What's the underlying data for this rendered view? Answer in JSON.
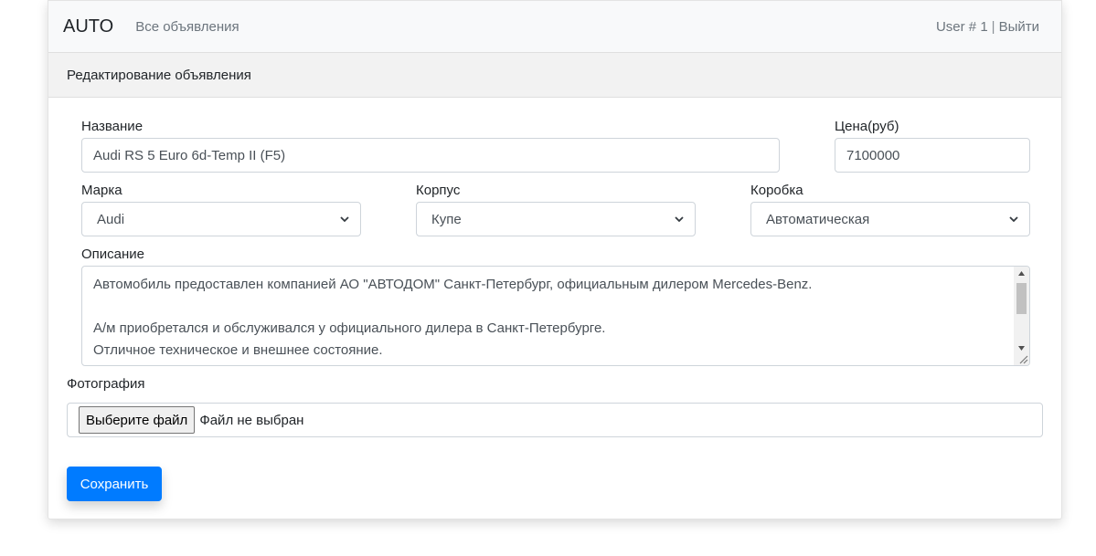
{
  "navbar": {
    "brand": "AUTO",
    "all_ads_link": "Все объявления",
    "user_label": "User # 1",
    "separator": "|",
    "logout_link": "Выйти"
  },
  "card": {
    "header_title": "Редактирование объявления"
  },
  "form": {
    "name": {
      "label": "Название",
      "value": "Audi RS 5 Euro 6d-Temp II (F5)"
    },
    "price": {
      "label": "Цена(руб)",
      "value": "7100000"
    },
    "brand": {
      "label": "Марка",
      "selected": "Audi",
      "icon": "chevron-down-icon"
    },
    "body": {
      "label": "Корпус",
      "selected": "Купе",
      "icon": "chevron-down-icon"
    },
    "gearbox": {
      "label": "Коробка",
      "selected": "Автоматическая",
      "icon": "chevron-down-icon"
    },
    "description": {
      "label": "Описание",
      "lines": [
        "Автомобиль предоставлен компанией АО \"АВТОДОМ\" Санкт-Петербург, официальным дилером Mercedes-Benz.",
        "",
        "А/м приобретался и обслуживался у официального дилера в Санкт-Петербурге.",
        "Отличное техническое и внешнее состояние."
      ]
    },
    "photo": {
      "label": "Фотография",
      "button_label": "Выберите файл",
      "status": "Файл не выбран"
    },
    "save_label": "Сохранить"
  },
  "colors": {
    "primary": "#007bff",
    "navbar_bg": "#f8f9fa",
    "header_bg": "#f2f2f2",
    "muted_text": "#6c757d",
    "input_border": "#ced4da"
  }
}
